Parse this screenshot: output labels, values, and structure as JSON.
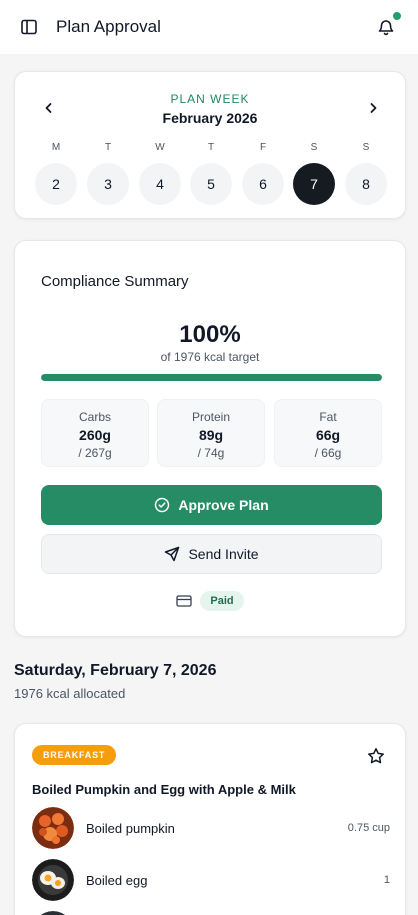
{
  "header": {
    "title": "Plan Approval",
    "sidebar_icon": "sidebar-panel-icon",
    "bell_icon": "bell-icon",
    "notification_dot_color": "#22a06b"
  },
  "week": {
    "label": "PLAN WEEK",
    "month": "February 2026",
    "days": [
      {
        "letter": "M",
        "num": "2"
      },
      {
        "letter": "T",
        "num": "3"
      },
      {
        "letter": "W",
        "num": "4"
      },
      {
        "letter": "T",
        "num": "5"
      },
      {
        "letter": "F",
        "num": "6"
      },
      {
        "letter": "S",
        "num": "7",
        "selected": true
      },
      {
        "letter": "S",
        "num": "8"
      }
    ]
  },
  "summary": {
    "title": "Compliance Summary",
    "percent": "100%",
    "target_text": "of 1976 kcal target",
    "progress_fraction": 1.0,
    "macros": [
      {
        "name": "Carbs",
        "value": "260g",
        "target": "/ 267g"
      },
      {
        "name": "Protein",
        "value": "89g",
        "target": "/ 74g"
      },
      {
        "name": "Fat",
        "value": "66g",
        "target": "/ 66g"
      }
    ],
    "approve_label": "Approve Plan",
    "invite_label": "Send Invite",
    "payment_status": "Paid",
    "accent_color": "#258c66"
  },
  "day": {
    "heading": "Saturday, February 7, 2026",
    "allocated": "1976 kcal allocated"
  },
  "meal": {
    "badge": "BREAKFAST",
    "badge_color": "#f59e0b",
    "title": "Boiled Pumpkin and Egg with Apple & Milk",
    "items": [
      {
        "name": "Boiled pumpkin",
        "qty": "0.75 cup"
      },
      {
        "name": "Boiled egg",
        "qty": "1"
      }
    ]
  }
}
